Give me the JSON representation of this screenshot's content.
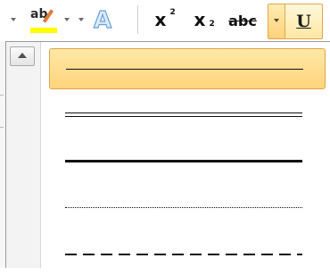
{
  "toolbar": {
    "highlight": {
      "label": "ab"
    },
    "font_color": {
      "label": "A"
    },
    "superscript": {
      "label": "x",
      "mark": "2"
    },
    "subscript": {
      "label": "x",
      "mark": "2"
    },
    "strikethrough": {
      "label": "abc"
    },
    "underline": {
      "label": "U"
    }
  },
  "underline_menu": {
    "options": [
      {
        "style": "single",
        "selected": true
      },
      {
        "style": "double",
        "selected": false
      },
      {
        "style": "thick",
        "selected": false
      },
      {
        "style": "dotted",
        "selected": false
      },
      {
        "style": "dashed",
        "selected": false
      }
    ]
  },
  "colors": {
    "highlight_yellow": "#ffff00",
    "selection_bg": "#ffd47c",
    "selection_border": "#e0a443",
    "font_color_blue": "#6aa0d8"
  }
}
